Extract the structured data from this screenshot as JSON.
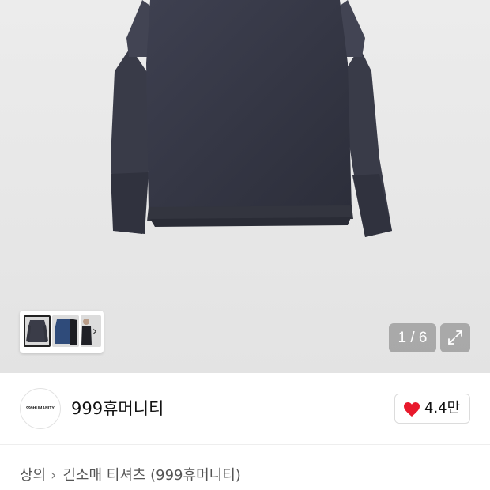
{
  "gallery": {
    "current_index": "1",
    "total": "6",
    "counter_text": "1 / 6",
    "thumbnails": [
      "product-front",
      "product-blue",
      "product-model"
    ],
    "expand_icon": "expand-icon",
    "next_icon": "chevron-right-icon"
  },
  "brand": {
    "logo_text": "999HUMANITY",
    "name": "999휴머니티"
  },
  "like": {
    "icon": "heart-icon",
    "count": "4.4만",
    "color": "#e8192c"
  },
  "breadcrumb": {
    "category": "상의",
    "separator_icon": "chevron-right-icon",
    "subcategory": "긴소매 티셔츠 (999휴머니티)"
  }
}
